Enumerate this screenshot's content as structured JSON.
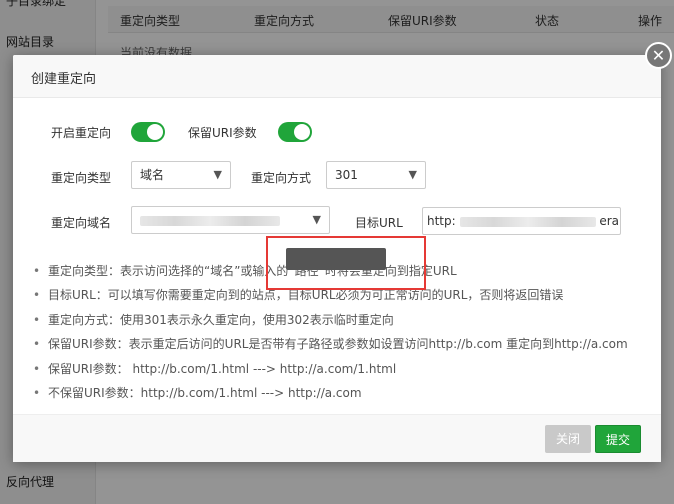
{
  "background": {
    "sidebar_items": [
      "子目录绑定",
      "网站目录",
      "反向代理"
    ],
    "table_headers": [
      "重定向类型",
      "重定向方式",
      "保留URI参数",
      "状态",
      "操作"
    ],
    "empty_text": "当前没有数据"
  },
  "dialog": {
    "title": "创建重定向",
    "close_icon": "close-icon",
    "enable_redirect": {
      "label": "开启重定向",
      "on": true
    },
    "keep_uri": {
      "label": "保留URI参数",
      "on": true
    },
    "redirect_type": {
      "label": "重定向类型",
      "value": "域名"
    },
    "redirect_method": {
      "label": "重定向方式",
      "value": "301"
    },
    "redirect_domain": {
      "label": "重定向域名"
    },
    "target_url": {
      "label": "目标URL",
      "value_prefix": "http:",
      "value_suffix": "era"
    },
    "tips": [
      "重定向类型：表示访问选择的“域名”或输入的“路径”时将会重定向到指定URL",
      "目标URL：可以填写你需要重定向到的站点，目标URL必须为可正常访问的URL，否则将返回错误",
      "重定向方式：使用301表示永久重定向，使用302表示临时重定向",
      "保留URI参数：表示重定后访问的URL是否带有子路径或参数如设置访问http://b.com 重定向到http://a.com",
      "保留URI参数：  http://b.com/1.html ---> http://a.com/1.html",
      "不保留URI参数：http://b.com/1.html ---> http://a.com"
    ],
    "buttons": {
      "close": "关闭",
      "submit": "提交"
    },
    "colors": {
      "accent": "#20a53a",
      "highlight": "#e53935"
    }
  }
}
